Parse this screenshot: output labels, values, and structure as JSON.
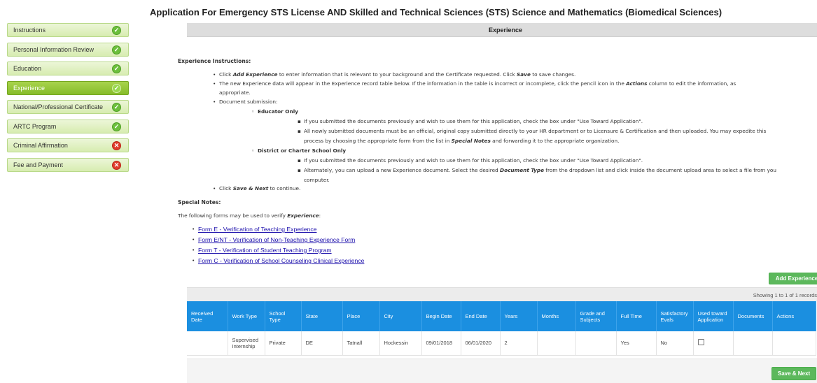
{
  "page_title": "Application For Emergency STS License AND Skilled and Technical Sciences (STS) Science and Mathematics (Biomedical Sciences)",
  "sidebar": {
    "items": [
      {
        "label": "Instructions",
        "status": "ok",
        "active": false
      },
      {
        "label": "Personal Information Review",
        "status": "ok",
        "active": false
      },
      {
        "label": "Education",
        "status": "ok",
        "active": false
      },
      {
        "label": "Experience",
        "status": "ok",
        "active": true
      },
      {
        "label": "National/Professional Certificate",
        "status": "ok",
        "active": false
      },
      {
        "label": "ARTC Program",
        "status": "ok",
        "active": false
      },
      {
        "label": "Criminal Affirmation",
        "status": "error",
        "active": false
      },
      {
        "label": "Fee and Payment",
        "status": "error",
        "active": false
      }
    ]
  },
  "panel": {
    "title": "Experience",
    "instructions_title": "Experience Instructions:",
    "instructions": {
      "b1_pre": "Click ",
      "b1_em1": "Add Experience",
      "b1_mid": " to enter information that is relevant to your background and the Certificate requested. Click ",
      "b1_em2": "Save",
      "b1_post": " to save changes.",
      "b2_pre": "The new Experience data will appear in the Experience record table below. If the information in the table is incorrect or incomplete, click the pencil icon in the ",
      "b2_em": "Actions",
      "b2_post": " column to edit the information, as",
      "b2_line2": "appropriate.",
      "b3": "Document submission:",
      "educator_title": "Educator Only",
      "edu_1": "If you submitted the documents previously and wish to use them for this application, check the box under \"Use Toward Application\".",
      "edu_2_line1": "All newly submitted documents must be an official, original copy submitted directly to your HR department or to Licensure & Certification and then uploaded. You may expedite this",
      "edu_2_pre": "process by choosing the appropriate form from the list in ",
      "edu_2_em": "Special Notes",
      "edu_2_post": " and forwarding it to the appropriate organization.",
      "district_title": "District or Charter School Only",
      "dist_1": "If you submitted the documents previously and wish to use them for this application, check the box under \"Use Toward Application\".",
      "dist_2_pre": "Alternately, you can upload a new Experience document. Select the desired ",
      "dist_2_em": "Document Type",
      "dist_2_post": " from the dropdown list and click inside the document upload area to select a file from you",
      "dist_2_line2": "computer.",
      "b4_pre": "Click ",
      "b4_em": "Save & Next",
      "b4_post": " to continue."
    },
    "special_notes_title": "Special Notes:",
    "special_notes_pre": "The following forms may be used to verify ",
    "special_notes_em": "Experience",
    "special_notes_post": ":",
    "forms": [
      "Form E - Verification of Teaching Experience",
      "Form E/NT - Verification of Non-Teaching Experience Form",
      "Form T - Verification of Student Teaching Program",
      "Form C - Verification of School Counseling Clinical Experience"
    ],
    "add_button": "Add Experience",
    "records_text": "Showing 1 to 1 of 1 records",
    "save_next": "Save & Next"
  },
  "table": {
    "headers": [
      "Received Date",
      "Work Type",
      "School Type",
      "State",
      "Place",
      "City",
      "Begin Date",
      "End Date",
      "Years",
      "Months",
      "Grade and Subjects",
      "Full Time",
      "Satisfactory Evals",
      "Used toward Application",
      "Documents",
      "Actions"
    ],
    "rows": [
      {
        "received_date": "",
        "work_type": "Supervised Internship",
        "school_type": "Private",
        "state": "DE",
        "place": "Tatnall",
        "city": "Hockessin",
        "begin_date": "09/01/2018",
        "end_date": "06/01/2020",
        "years": "2",
        "months": "",
        "grade_subjects": "",
        "full_time": "Yes",
        "satisfactory_evals": "No",
        "documents": "",
        "actions": ""
      }
    ]
  },
  "colors": {
    "header_blue": "#1b8fe0",
    "sidebar_green": "#d7ecb0",
    "active_green": "#86bc2a",
    "button_green": "#5cb85c",
    "error_red": "#e03c2c"
  }
}
